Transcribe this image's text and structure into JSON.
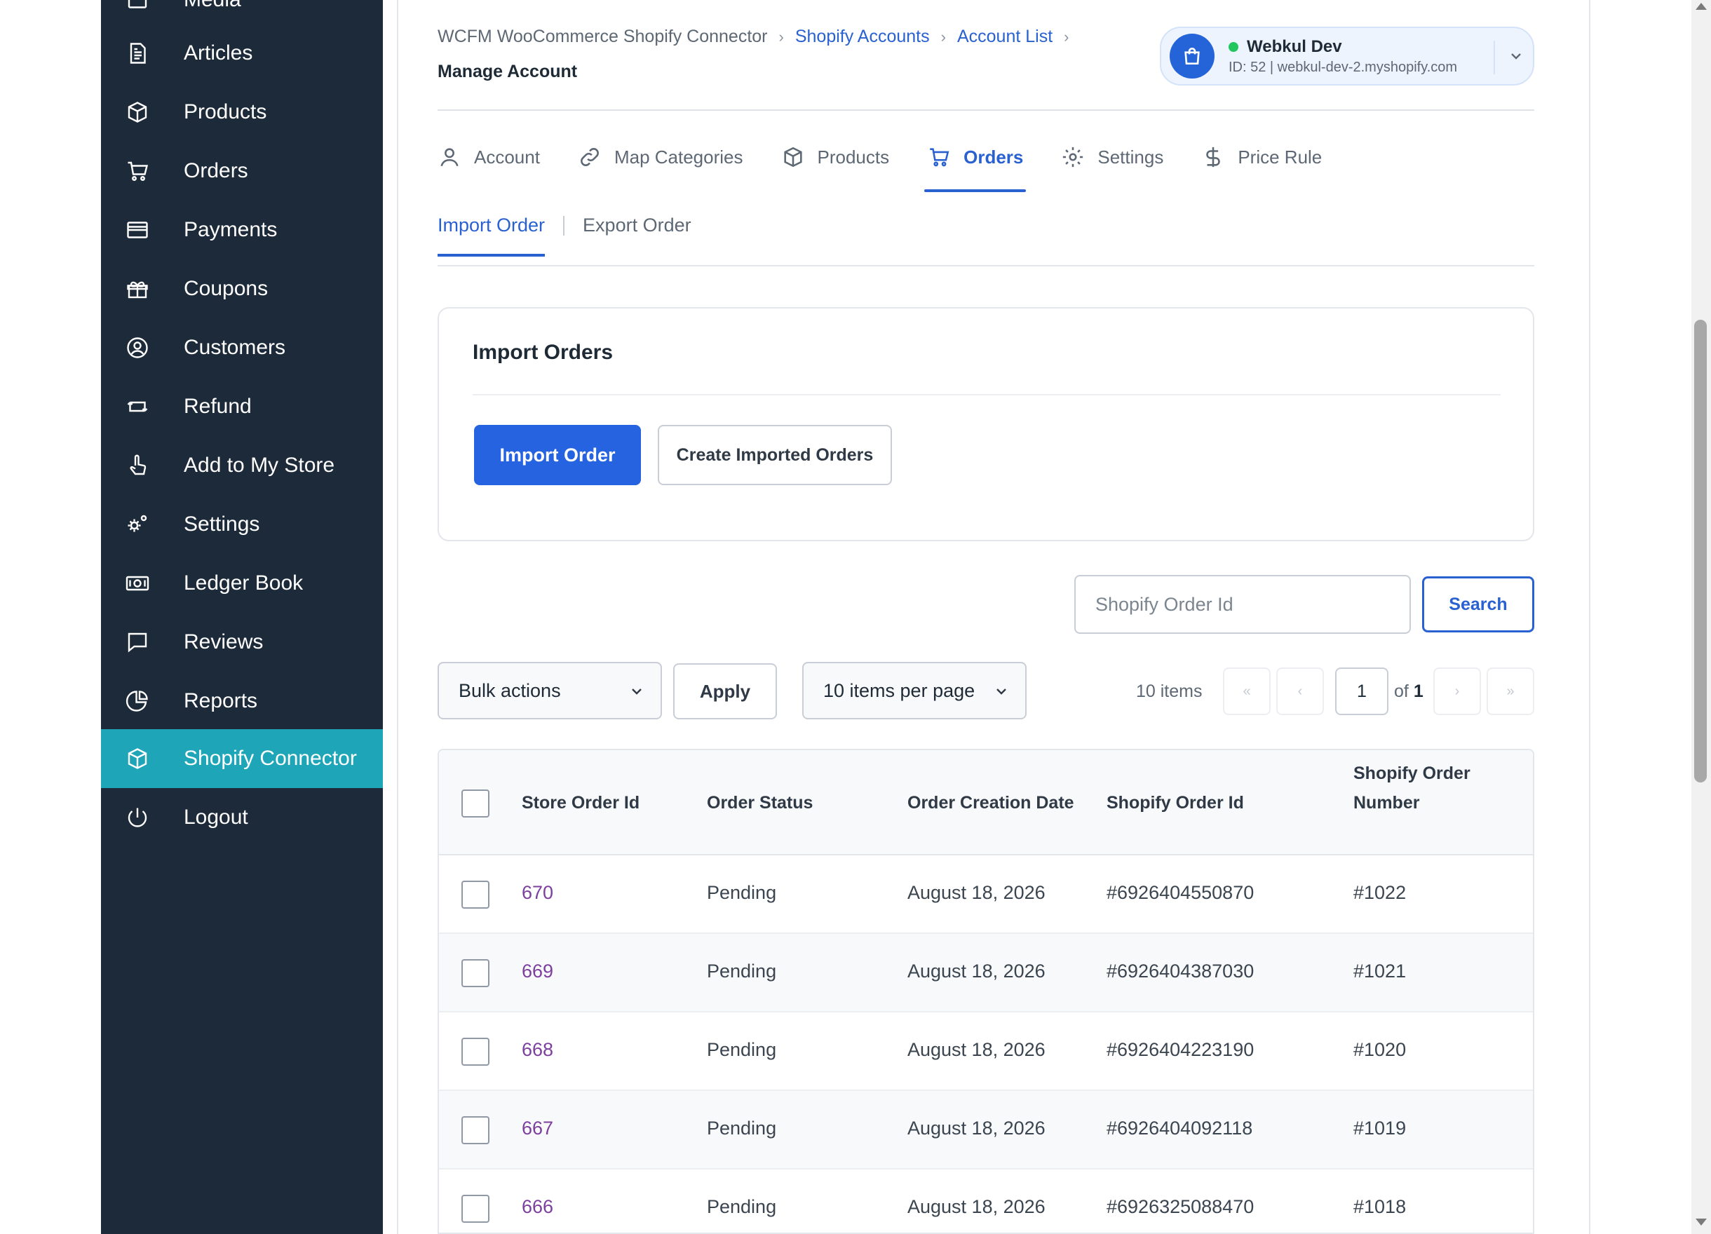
{
  "sidebar": {
    "items": [
      {
        "label": "Media",
        "icon": "media-icon"
      },
      {
        "label": "Articles",
        "icon": "article-icon"
      },
      {
        "label": "Products",
        "icon": "box-icon"
      },
      {
        "label": "Orders",
        "icon": "cart-icon"
      },
      {
        "label": "Payments",
        "icon": "credit-card-icon"
      },
      {
        "label": "Coupons",
        "icon": "gift-icon"
      },
      {
        "label": "Customers",
        "icon": "user-circle-icon"
      },
      {
        "label": "Refund",
        "icon": "refund-icon"
      },
      {
        "label": "Add to My Store",
        "icon": "hand-pointer-icon"
      },
      {
        "label": "Settings",
        "icon": "gears-icon"
      },
      {
        "label": "Ledger Book",
        "icon": "money-icon"
      },
      {
        "label": "Reviews",
        "icon": "comment-icon"
      },
      {
        "label": "Reports",
        "icon": "pie-chart-icon"
      },
      {
        "label": "Shopify Connector",
        "icon": "box-icon",
        "active": true
      },
      {
        "label": "Logout",
        "icon": "power-icon"
      }
    ],
    "background": "#1c2a39",
    "active_color": "#1ea6b8"
  },
  "breadcrumb": {
    "root": "WCFM WooCommerce Shopify Connector",
    "accounts": "Shopify Accounts",
    "list": "Account List",
    "current": "Manage Account"
  },
  "account": {
    "name": "Webkul Dev",
    "detail": "ID: 52 | webkul-dev-2.myshopify.com",
    "status_color": "#22c55e"
  },
  "tabs": [
    {
      "label": "Account",
      "icon": "user-icon"
    },
    {
      "label": "Map Categories",
      "icon": "link-icon"
    },
    {
      "label": "Products",
      "icon": "box-icon"
    },
    {
      "label": "Orders",
      "icon": "cart-icon",
      "active": true
    },
    {
      "label": "Settings",
      "icon": "gear-icon"
    },
    {
      "label": "Price Rule",
      "icon": "dollar-icon"
    }
  ],
  "subtabs": {
    "import": "Import Order",
    "export": "Export Order"
  },
  "import_box": {
    "title": "Import Orders",
    "import_button": "Import Order",
    "create_button": "Create Imported Orders"
  },
  "search": {
    "placeholder": "Shopify Order Id",
    "button": "Search"
  },
  "controls": {
    "bulk_actions": "Bulk actions",
    "apply": "Apply",
    "per_page": "10 items per page"
  },
  "pagination": {
    "count": "10 items",
    "first": "«",
    "prev": "‹",
    "current_page": "1",
    "of_label": "of",
    "total_pages": "1",
    "next": "›",
    "last": "»"
  },
  "table": {
    "headers": {
      "store_order_id": "Store Order Id",
      "order_status": "Order Status",
      "order_creation_date": "Order Creation Date",
      "shopify_order_id": "Shopify Order Id",
      "shopify_order_number_1": "Shopify Order",
      "shopify_order_number_2": "Number"
    },
    "rows": [
      {
        "store_id": "670",
        "status": "Pending",
        "date": "August 18, 2026",
        "shopify_id": "#6926404550870",
        "number": "#1022"
      },
      {
        "store_id": "669",
        "status": "Pending",
        "date": "August 18, 2026",
        "shopify_id": "#6926404387030",
        "number": "#1021"
      },
      {
        "store_id": "668",
        "status": "Pending",
        "date": "August 18, 2026",
        "shopify_id": "#6926404223190",
        "number": "#1020"
      },
      {
        "store_id": "667",
        "status": "Pending",
        "date": "August 18, 2026",
        "shopify_id": "#6926404092118",
        "number": "#1019"
      },
      {
        "store_id": "666",
        "status": "Pending",
        "date": "August 18, 2026",
        "shopify_id": "#6926325088470",
        "number": "#1018"
      }
    ]
  },
  "colors": {
    "accent": "#2563e0",
    "link": "#2a61d1",
    "order_link": "#7c3f9e"
  }
}
